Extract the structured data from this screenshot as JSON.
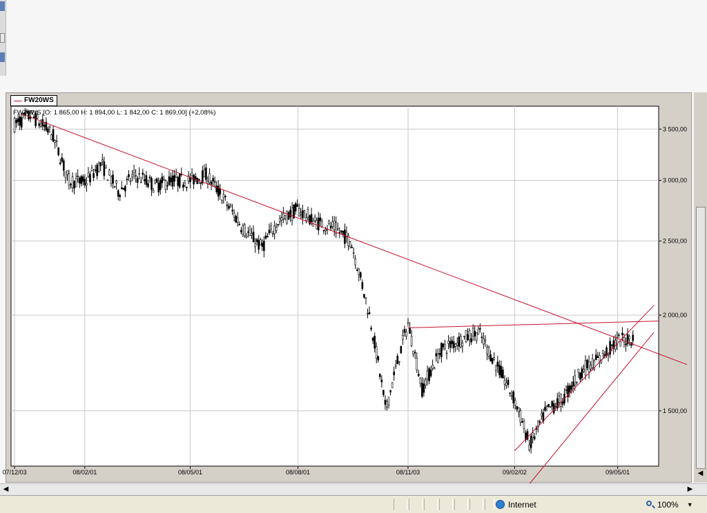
{
  "legend": {
    "label": "FW20WS"
  },
  "ohlc_info": "FW20WS [O: 1 865,00  H: 1 894,00  L: 1 842,00  C: 1 869,00] (+2,08%)",
  "status": {
    "zone": "Internet",
    "zoom": "100%"
  },
  "colors": {
    "trendline": "#c8102e",
    "candles": "#000000",
    "grid": "#c8c8c8"
  },
  "chart_data": {
    "type": "line",
    "title": "",
    "series": [
      {
        "name": "FW20WS",
        "x": [
          "07/12/03",
          "07/12/17",
          "08/01/04",
          "08/01/18",
          "08/02/01",
          "08/02/15",
          "08/03/01",
          "08/03/15",
          "08/04/01",
          "08/04/15",
          "08/05/01",
          "08/05/15",
          "08/06/01",
          "08/06/15",
          "08/07/01",
          "08/07/15",
          "08/08/01",
          "08/08/15",
          "08/09/01",
          "08/09/15",
          "08/10/01",
          "08/10/15",
          "08/11/03",
          "08/11/15",
          "08/12/01",
          "08/12/15",
          "09/01/02",
          "09/01/15",
          "09/02/02",
          "09/02/15",
          "09/03/01",
          "09/03/15",
          "09/04/01",
          "09/04/15",
          "09/05/01",
          "09/05/15"
        ],
        "values": [
          3550,
          3650,
          3450,
          3000,
          2980,
          3150,
          2900,
          3050,
          2950,
          3000,
          3000,
          3050,
          2800,
          2600,
          2450,
          2650,
          2750,
          2650,
          2600,
          2500,
          2000,
          1500,
          1950,
          1600,
          1800,
          1850,
          1900,
          1750,
          1550,
          1350,
          1500,
          1550,
          1700,
          1750,
          1850,
          1869
        ]
      }
    ],
    "ohlc_last": {
      "open": 1865.0,
      "high": 1894.0,
      "low": 1842.0,
      "close": 1869.0,
      "change_pct": "+2,08%"
    },
    "x_tick_labels": [
      "07/12/03",
      "08/02/01",
      "08/05/01",
      "08/08/01",
      "08/11/03",
      "09/02/02",
      "09/05/01"
    ],
    "y_tick_labels": [
      "3 500,00",
      "3 000,00",
      "2 500,00",
      "2 000,00",
      "1 500,00"
    ],
    "y_ticks": [
      3500,
      3000,
      2500,
      2000,
      1500
    ],
    "ylim": [
      1270,
      3750
    ],
    "y_scale": "log",
    "grid": true,
    "x_range": [
      "07/11/30",
      "09/06/05"
    ],
    "trendlines": [
      {
        "x": [
          "07/12/10",
          "09/06/05"
        ],
        "y": [
          3660,
          1780
        ]
      },
      {
        "x": [
          "08/11/03",
          "09/06/05"
        ],
        "y": [
          1925,
          1965
        ]
      },
      {
        "x": [
          "09/02/02",
          "09/06/01"
        ],
        "y": [
          1330,
          2060
        ]
      },
      {
        "x": [
          "09/02/10",
          "09/06/01"
        ],
        "y": [
          1180,
          1900
        ]
      }
    ]
  }
}
